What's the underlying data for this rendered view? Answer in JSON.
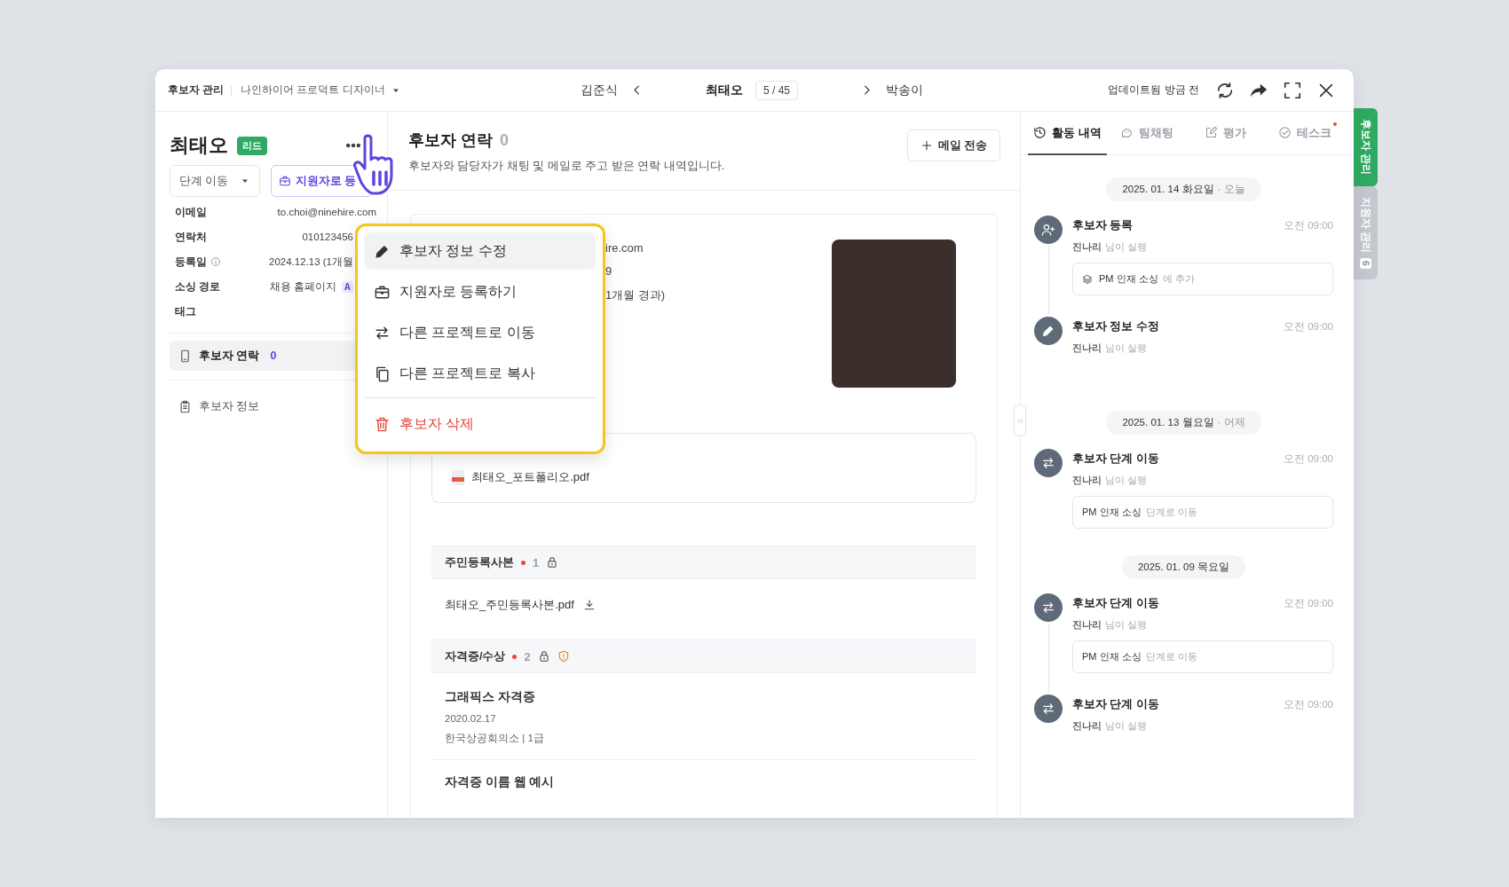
{
  "header": {
    "breadcrumb": "후보자 관리",
    "project": "나인하이어 프로덕트 디자이너",
    "prev": "김준식",
    "current": "최태오",
    "position": "5 / 45",
    "next": "박송이",
    "updated": "업데이트됨 방금 전"
  },
  "profile": {
    "name": "최태오",
    "badge": "리드",
    "stage_select": "단계 이동",
    "register_button": "지원자로 등"
  },
  "fields": [
    {
      "label": "이메일",
      "value": "to.choi@ninehire.com"
    },
    {
      "label": "연락처",
      "value": "010123456"
    },
    {
      "label": "등록일",
      "info": true,
      "value": "2024.12.13 (1개월"
    },
    {
      "label": "소싱 경로",
      "value": "채용 홈페이지",
      "tag": "A"
    },
    {
      "label": "태그"
    }
  ],
  "nav": [
    {
      "label": "후보자 연락",
      "count": "0",
      "selected": true
    },
    {
      "label": "후보자 정보",
      "selected": false
    }
  ],
  "menu": [
    {
      "label": "후보자 정보 수정",
      "kind": "normal",
      "highlighted": true
    },
    {
      "label": "지원자로 등록하기",
      "kind": "normal",
      "highlighted": false
    },
    {
      "label": "다른 프로젝트로 이동",
      "kind": "normal",
      "highlighted": false
    },
    {
      "label": "다른 프로젝트로 복사",
      "kind": "normal",
      "highlighted": false
    },
    {
      "label": "후보자 삭제",
      "kind": "danger",
      "highlighted": false
    }
  ],
  "contact": {
    "title": "후보자 연락",
    "count": "0",
    "subtitle": "후보자와 담당자가 채팅 및 메일로 주고 받은 연락 내역입니다.",
    "mail_button": "메일 전송"
  },
  "profile_fragments": [
    "ire.com",
    "9",
    "1개월 경과)"
  ],
  "portfolio_file": "최태오_포트폴리오.pdf",
  "sections": [
    {
      "title": "주민등록사본",
      "count": "1",
      "required": true,
      "locked": true,
      "warning": false,
      "files": [
        "최태오_주민등록사본.pdf"
      ]
    },
    {
      "title": "자격증/수상",
      "count": "2",
      "required": true,
      "locked": true,
      "warning": true,
      "items": [
        {
          "name": "그래픽스 자격증",
          "date": "2020.02.17",
          "issuer": "한국상공회의소 | 1급"
        },
        {
          "name": "자격증 이름 웹 예시"
        }
      ]
    }
  ],
  "activity_tabs": [
    {
      "label": "활동 내역",
      "selected": true,
      "dot": false
    },
    {
      "label": "팀채팅",
      "selected": false,
      "dot": false
    },
    {
      "label": "평가",
      "selected": false,
      "dot": false
    },
    {
      "label": "테스크",
      "selected": false,
      "dot": true
    }
  ],
  "timeline": [
    {
      "date": "2025. 01. 14 화요일",
      "relative": "· 오늘",
      "entries": [
        {
          "kind": "register",
          "title": "후보자 등록",
          "time": "오전 09:00",
          "actor": "진나리",
          "action": "님이 실행",
          "detail": {
            "kind": "project",
            "label": "PM 인재 소싱",
            "suffix": "에 추가"
          }
        },
        {
          "kind": "edit",
          "title": "후보자 정보 수정",
          "time": "오전 09:00",
          "actor": "진나리",
          "action": "님이 실행"
        }
      ]
    },
    {
      "date": "2025. 01. 13 월요일",
      "relative": "· 어제",
      "entries": [
        {
          "kind": "move",
          "title": "후보자 단계 이동",
          "time": "오전 09:00",
          "actor": "진나리",
          "action": "님이 실행",
          "detail": {
            "kind": "stage",
            "label": "PM 인재 소싱",
            "suffix": "단계로 이동"
          }
        }
      ]
    },
    {
      "date": "2025. 01. 09 목요일",
      "entries": [
        {
          "kind": "move",
          "title": "후보자 단계 이동",
          "time": "오전 09:00",
          "actor": "진나리",
          "action": "님이 실행",
          "detail": {
            "kind": "stage",
            "label": "PM 인재 소싱",
            "suffix": "단계로 이동"
          }
        },
        {
          "kind": "move",
          "title": "후보자 단계 이동",
          "time": "오전 09:00",
          "actor": "진나리",
          "action": "님이 실행"
        }
      ]
    }
  ],
  "side_tabs": [
    {
      "label": "후보자 관리",
      "selected": true
    },
    {
      "label": "지원자 관리",
      "count": "6",
      "selected": false
    }
  ]
}
